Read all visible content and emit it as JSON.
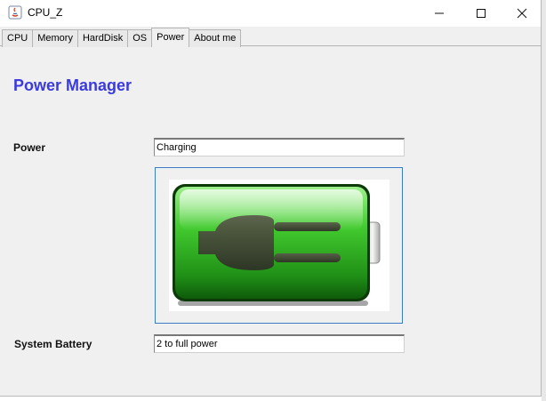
{
  "window": {
    "title": "CPU_Z"
  },
  "tabs": [
    {
      "label": "CPU"
    },
    {
      "label": "Memory"
    },
    {
      "label": "HardDisk"
    },
    {
      "label": "OS"
    },
    {
      "label": "Power",
      "active": true
    },
    {
      "label": "About me"
    }
  ],
  "main": {
    "heading": "Power Manager",
    "power_label": "Power",
    "power_value": "Charging",
    "battery_label": "System Battery",
    "battery_value": "2 to full power",
    "battery_image_icon": "battery-charging-plug-icon"
  },
  "colors": {
    "heading": "#3a3ae0",
    "battery_green": "#3cc22c",
    "panel_border": "#3b7cc4"
  }
}
